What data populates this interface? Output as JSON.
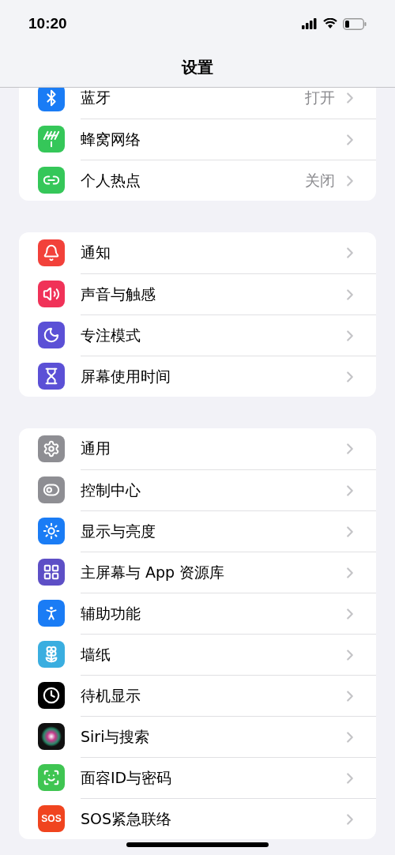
{
  "status_bar": {
    "time": "10:20"
  },
  "nav": {
    "title": "设置"
  },
  "groups": [
    {
      "rows": [
        {
          "label": "蓝牙",
          "value": "打开",
          "color": "#1a7cf5"
        },
        {
          "label": "蜂窝网络",
          "color": "#35c759"
        },
        {
          "label": "个人热点",
          "value": "关闭",
          "color": "#35c759"
        }
      ]
    },
    {
      "rows": [
        {
          "label": "通知",
          "color": "#f2413a"
        },
        {
          "label": "声音与触感",
          "color": "#f03258"
        },
        {
          "label": "专注模式",
          "color": "#5b50d6"
        },
        {
          "label": "屏幕使用时间",
          "color": "#5b50d6"
        }
      ]
    },
    {
      "rows": [
        {
          "label": "通用",
          "color": "#8e8e93"
        },
        {
          "label": "控制中心",
          "color": "#8e8e93"
        },
        {
          "label": "显示与亮度",
          "color": "#1a7cf5"
        },
        {
          "label": "主屏幕与 App 资源库",
          "color": "#5d4fc6"
        },
        {
          "label": "辅助功能",
          "color": "#1a7cf5"
        },
        {
          "label": "墙纸",
          "color": "#3aaee0"
        },
        {
          "label": "待机显示",
          "color": "#000000"
        },
        {
          "label": "Siri与搜索",
          "color": "#111111"
        },
        {
          "label": "面容ID与密码",
          "color": "#3fc552"
        },
        {
          "label": "SOS紧急联络",
          "color": "#f0441f",
          "icon_text": "SOS"
        }
      ]
    }
  ]
}
